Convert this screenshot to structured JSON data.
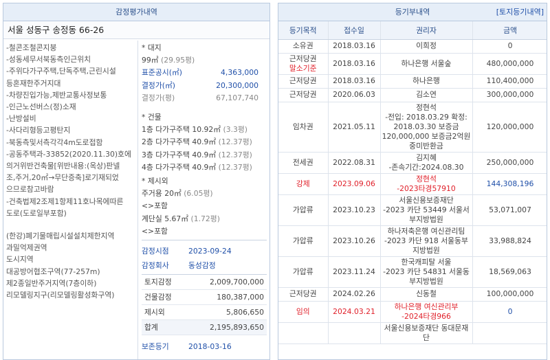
{
  "left_panel": {
    "title": "감정평가내역",
    "address": "서울 성동구 송정동 66-26",
    "notes": [
      "-철콘조철콘지붕",
      "-성동세무서북동측인근위치",
      "-주위다가구주택,단독주택,근린시설",
      "등혼재한주거지대",
      "-차량진입가능,제반교통사정보통",
      "-인근노선버스(정)소재",
      "-난방설비",
      "-사다리형등고평탄지",
      "-북동측및서측각각4m도로접함",
      "-공동주택과-33852(2020.11.30)호에",
      "의거위반건축물[위반내용:(옥상)판넬",
      "조,주거,20㎡→무단증축]로기재되었",
      "으므로참고바람",
      "-건축법제2조제1항제11호나목에따른",
      "도로(도로일부포함)",
      "",
      "(한강)폐기물매립시설설치제한지역",
      "과밀억제권역",
      "도시지역",
      "대공방어협조구역(77-257m)",
      "제2종일반주거지역(7층이하)",
      "리모델링지구(리모델링활성화구역)"
    ],
    "land": {
      "heading": "* 대지",
      "area": "99㎡",
      "area_pyeong": "(29.95평)",
      "official_price_label": "표준공시(㎡)",
      "official_price": "4,363,000",
      "appraisal_label": "결정가(㎡)",
      "appraisal_price": "20,300,000",
      "pyeong_label": "결정가(평)",
      "pyeong_price": "67,107,740"
    },
    "building": {
      "heading": "* 건물",
      "floors": [
        {
          "label": "1층 다가구주택 10.92㎡",
          "pyeong": "(3.3평)"
        },
        {
          "label": "2층 다가구주택 40.9㎡",
          "pyeong": "(12.37평)"
        },
        {
          "label": "3층 다가구주택 40.9㎡",
          "pyeong": "(12.37평)"
        },
        {
          "label": "4층 다가구주택 40.9㎡",
          "pyeong": "(12.37평)"
        }
      ]
    },
    "excluded": {
      "heading": "* 제시외",
      "items": [
        {
          "label": "주거용 20㎡",
          "pyeong": "(6.05평)"
        },
        {
          "label": "<>포함",
          "pyeong": ""
        },
        {
          "label": "계단실 5.67㎡",
          "pyeong": "(1.72평)"
        },
        {
          "label": "<>포함",
          "pyeong": ""
        }
      ]
    },
    "appraisal_date_label": "감정시점",
    "appraisal_date": "2023-09-24",
    "appraiser_label": "감정회사",
    "appraiser": "동성감정",
    "values": [
      {
        "k": "토지감정",
        "v": "2,009,700,000"
      },
      {
        "k": "건물감정",
        "v": "180,387,000"
      },
      {
        "k": "제시외",
        "v": "5,806,650"
      },
      {
        "k": "합계",
        "v": "2,195,893,650"
      }
    ],
    "preserve_label": "보존등기",
    "preserve_date": "2018-03-16"
  },
  "right_panel": {
    "title": "등기부내역",
    "land_register_link": "[토지등기내역]",
    "columns": [
      "등기목적",
      "접수일",
      "권리자",
      "금액"
    ],
    "rows": [
      {
        "purpose": "소유권",
        "purpose2": "",
        "date": "2018.03.16",
        "holder": "이희정",
        "amount": "0",
        "red": false
      },
      {
        "purpose": "근저당권",
        "purpose2": "말소기준",
        "date": "2018.03.16",
        "holder": "하나은행 서울숲",
        "amount": "480,000,000",
        "red": false
      },
      {
        "purpose": "근저당권",
        "purpose2": "",
        "date": "2018.03.16",
        "holder": "하나은행",
        "amount": "110,400,000",
        "red": false
      },
      {
        "purpose": "근저당권",
        "purpose2": "",
        "date": "2020.06.03",
        "holder": "김소연",
        "amount": "300,000,000",
        "red": false
      },
      {
        "purpose": "임차권",
        "purpose2": "",
        "date": "2021.05.11",
        "holder": "정현석\n-전입: 2018.03.29 확정: 2018.03.30 보증금 120,000,000 보증금2억원 중미반환금",
        "amount": "120,000,000",
        "red": false
      },
      {
        "purpose": "전세권",
        "purpose2": "",
        "date": "2022.08.31",
        "holder": "김지혜\n-존속기간:2024.08.30",
        "amount": "250,000,000",
        "red": false
      },
      {
        "purpose": "강제",
        "purpose2": "",
        "date": "2023.09.06",
        "holder": "정현석\n-2023타경57910",
        "amount": "144,308,196",
        "red": true
      },
      {
        "purpose": "가압류",
        "purpose2": "",
        "date": "2023.10.23",
        "holder": "서울신용보증재단\n-2023 카단 53449 서울서부지방법원",
        "amount": "53,071,007",
        "red": false
      },
      {
        "purpose": "가압류",
        "purpose2": "",
        "date": "2023.10.26",
        "holder": "하나저축은행 여신관리팀\n-2023 카단 918 서울동부지방법원",
        "amount": "33,988,824",
        "red": false
      },
      {
        "purpose": "가압류",
        "purpose2": "",
        "date": "2023.11.24",
        "holder": "한국캐피탈 서울\n-2023 카단 54831 서울동부지방법원",
        "amount": "18,569,063",
        "red": false
      },
      {
        "purpose": "근저당권",
        "purpose2": "",
        "date": "2024.02.26",
        "holder": "신동철",
        "amount": "100,000,000",
        "red": false
      },
      {
        "purpose": "임의",
        "purpose2": "",
        "date": "2024.03.21",
        "holder": "하나은행 여신관리부\n-2024타경966",
        "amount": "0",
        "red": true
      },
      {
        "purpose": "",
        "purpose2": "",
        "date": "",
        "holder": "서울신용보증재단 동대문재단",
        "amount": "",
        "red": false
      }
    ]
  },
  "colors": {
    "header_bg": "#e6eef8",
    "accent_blue": "#1f4fa8",
    "red": "#e0202a",
    "border": "#b9c9de"
  }
}
